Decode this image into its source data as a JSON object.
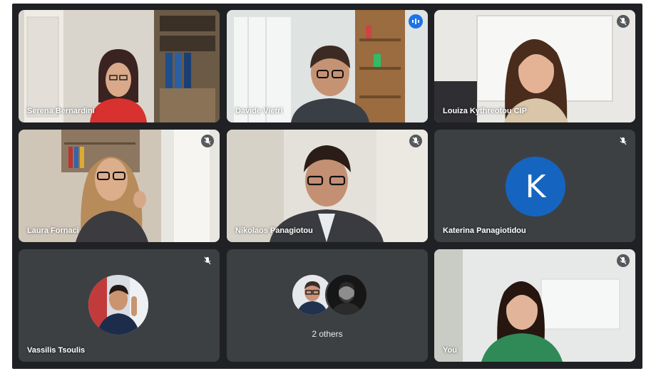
{
  "participants": [
    {
      "name": "Serena Bernardini",
      "muted": false,
      "speaking": false
    },
    {
      "name": "Davide Vietri",
      "muted": false,
      "speaking": true
    },
    {
      "name": "Louiza Kythreotou CIP",
      "muted": true,
      "speaking": false
    },
    {
      "name": "Laura Fornaci",
      "muted": true,
      "speaking": false
    },
    {
      "name": "Nikolaos Panagiotou",
      "muted": true,
      "speaking": false
    },
    {
      "name": "Katerina Panagiotidou",
      "muted": true,
      "speaking": false,
      "avatar_letter": "K"
    },
    {
      "name": "Vassilis Tsoulis",
      "muted": true,
      "speaking": false
    },
    {
      "name": "",
      "muted": false,
      "speaking": false,
      "others_label": "2 others"
    },
    {
      "name": "You",
      "muted": true,
      "speaking": false
    }
  ],
  "colors": {
    "stage_bg": "#202124",
    "tile_bg": "#3c4043",
    "active_border": "#8ab4f8",
    "speaking_badge": "#1a73e8",
    "avatar_k_bg": "#1565c0"
  },
  "icons": {
    "mute": "mic-off-icon",
    "speaking": "audio-level-icon"
  }
}
